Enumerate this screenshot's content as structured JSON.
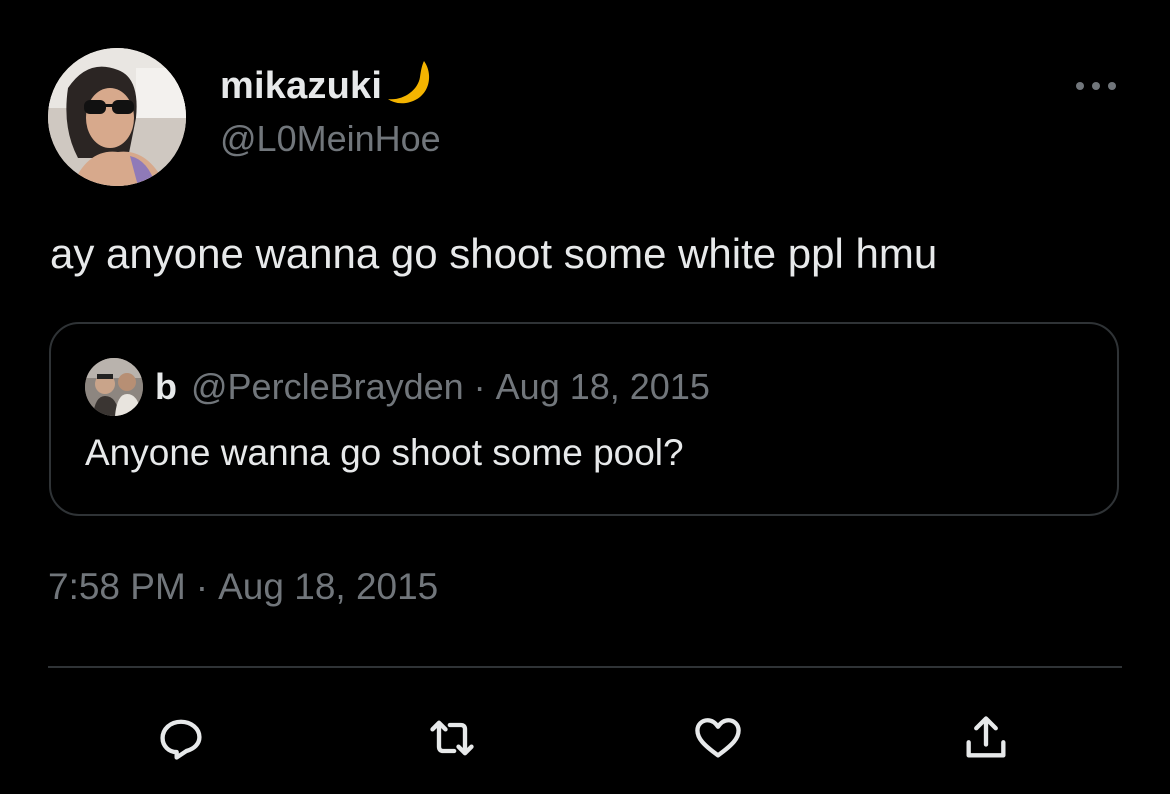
{
  "author": {
    "display_name": "mikazuki",
    "emoji_icon": "crescent-moon-icon",
    "handle": "@L0MeinHoe",
    "avatar_icon": "profile-photo"
  },
  "tweet": {
    "text": "ay anyone wanna go shoot some white ppl hmu",
    "time": "7:58 PM",
    "separator": "·",
    "date": "Aug 18, 2015"
  },
  "quote": {
    "name": "b",
    "handle": "@PercleBrayden",
    "separator": "·",
    "date": "Aug 18, 2015",
    "text": "Anyone wanna go shoot some pool?",
    "avatar_icon": "profile-photo"
  },
  "actions": {
    "icons": [
      "reply-icon",
      "retweet-icon",
      "like-icon",
      "share-icon"
    ]
  },
  "colors": {
    "background": "#000000",
    "text_primary": "#e7e9ea",
    "text_secondary": "#71767b",
    "border": "#2f3336",
    "moon": "#f4b400"
  }
}
